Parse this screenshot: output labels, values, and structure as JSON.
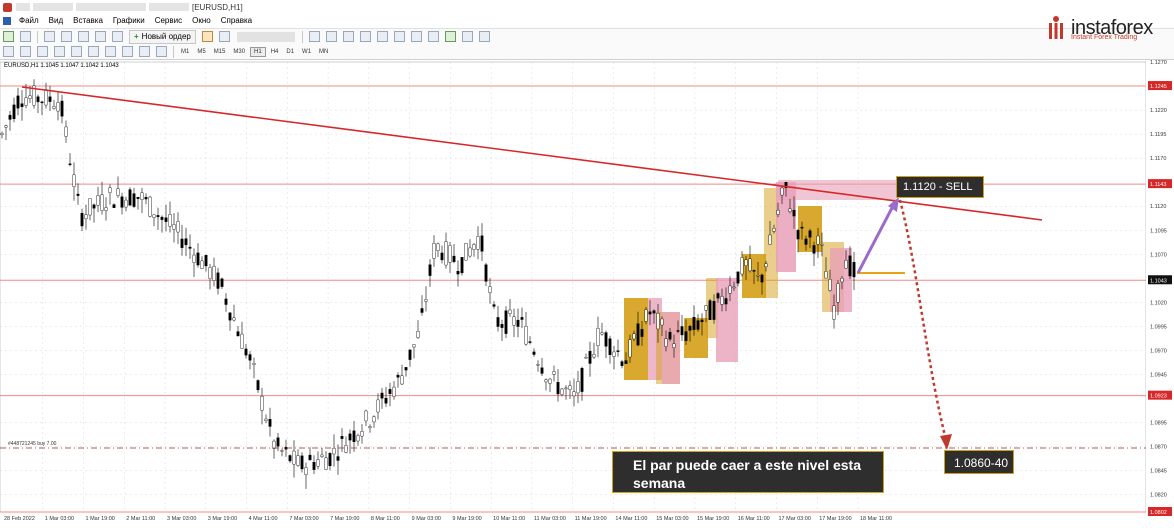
{
  "window": {
    "title": "[EURUSD,H1]"
  },
  "menu": [
    "Файл",
    "Вид",
    "Вставка",
    "Графики",
    "Сервис",
    "Окно",
    "Справка"
  ],
  "toolbar": {
    "new_order_label": "Новый ордер",
    "timeframes": [
      "M1",
      "M5",
      "M15",
      "M30",
      "H1",
      "H4",
      "D1",
      "W1",
      "MN"
    ],
    "active_timeframe": "H1"
  },
  "logo": {
    "name": "instaforex",
    "tagline": "Instant Forex Trading",
    "color": "#c0392b"
  },
  "chart": {
    "symbol_header": "EURUSD,H1  1.1045 1.1047 1.1042 1.1043",
    "order_label": "#448721245 buy 7.00",
    "price_ticks": [
      "1.1270",
      "1.1245",
      "1.1220",
      "1.1195",
      "1.1170",
      "1.1143",
      "1.1120",
      "1.1095",
      "1.1070",
      "1.1043",
      "1.1020",
      "1.0995",
      "1.0970",
      "1.0945",
      "1.0923",
      "1.0895",
      "1.0870",
      "1.0845",
      "1.0820",
      "1.0802"
    ],
    "highlighted_prices": [
      "1.1245",
      "1.1143",
      "1.1043",
      "1.0923",
      "1.0802"
    ],
    "current_price": "1.1043",
    "time_ticks": [
      "28 Feb 2022",
      "1 Mar 03:00",
      "1 Mar 19:00",
      "2 Mar 11:00",
      "3 Mar 03:00",
      "3 Mar 19:00",
      "4 Mar 11:00",
      "7 Mar 03:00",
      "7 Mar 19:00",
      "8 Mar 11:00",
      "9 Mar 03:00",
      "9 Mar 19:00",
      "10 Mar 11:00",
      "11 Mar 03:00",
      "11 Mar 19:00",
      "14 Mar 11:00",
      "15 Mar 03:00",
      "15 Mar 19:00",
      "16 Mar 11:00",
      "17 Mar 03:00",
      "17 Mar 19:00",
      "18 Mar 11:00"
    ],
    "colors": {
      "resistance": "#d62828",
      "bull_box": "#d4a017",
      "bear_box": "#e8a0b8",
      "arrow_up": "#9b6bc9",
      "arrow_down": "#c0392b"
    }
  },
  "annotations": {
    "sell_label": "1.1120 - SELL",
    "target_label": "1.0860-40",
    "note": "El par puede caer a este nivel esta semana"
  }
}
